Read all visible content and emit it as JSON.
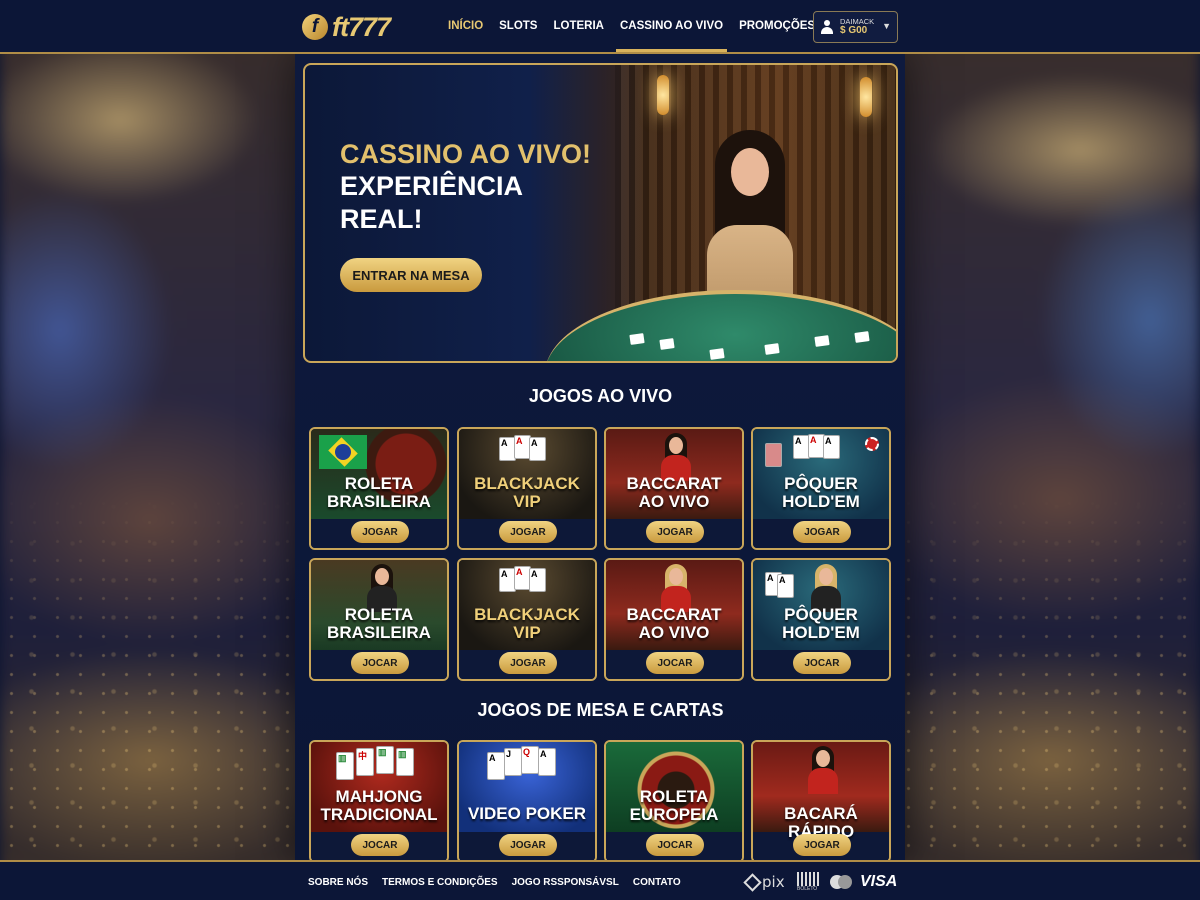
{
  "brand": {
    "logo_letter": "f",
    "logo_text": "ft777"
  },
  "nav": {
    "items": [
      {
        "label": "INÍCIO"
      },
      {
        "label": "SLOTS"
      },
      {
        "label": "LOTERIA"
      },
      {
        "label": "CASSINO AO VIVO"
      },
      {
        "label": "PROMOÇÕES"
      }
    ],
    "active_index": 3
  },
  "account": {
    "label": "DAIMACK",
    "balance": "$ G00"
  },
  "hero": {
    "line1": "CASSINO AO VIVO!",
    "line2": "EXPERIÊNCIA",
    "line3": "REAL!",
    "cta": "ENTRAR NA MESA"
  },
  "live": {
    "title": "JOGOS AO VIVO",
    "cards": [
      {
        "line1": "ROLETA",
        "line2": "BRASILEIRA",
        "button": "JOGAR"
      },
      {
        "line1": "BLACKJACK",
        "line2": "VIP",
        "button": "JOGAR"
      },
      {
        "line1": "BACCARAT",
        "line2": "AO VIVO",
        "button": "JOGAR"
      },
      {
        "line1": "PÔQUER",
        "line2": "HOLD'EM",
        "button": "JOGAR"
      },
      {
        "line1": "ROLETA",
        "line2": "BRASILEIRA",
        "button": "JOCAR"
      },
      {
        "line1": "BLACKJACK",
        "line2": "VIP",
        "button": "JOGAR"
      },
      {
        "line1": "BACCARAT",
        "line2": "AO VIVO",
        "button": "JOCAR"
      },
      {
        "line1": "PÔQUER",
        "line2": "HOLD'EM",
        "button": "JOCAR"
      }
    ]
  },
  "table": {
    "title": "JOGOS DE MESA E CARTAS",
    "cards": [
      {
        "line1": "MAHJONG",
        "line2": "TRADICIONAL",
        "button": "JOCAR"
      },
      {
        "line1": "VIDEO POKER",
        "line2": "",
        "button": "JOGAR"
      },
      {
        "line1": "ROLETA",
        "line2": "EUROPEIA",
        "button": "JOCAR"
      },
      {
        "line1": "BACARÁ RÁPIDO",
        "line2": "",
        "button": "JOGAR"
      }
    ]
  },
  "footer": {
    "links": [
      "SOBRE NÓS",
      "TERMOS E CONDIÇÕES",
      "JOGO RSSPONSÁVSL",
      "CONTATO"
    ],
    "payments": {
      "pix": "pix",
      "boleto": "BOLETO",
      "visa": "VISA"
    }
  }
}
